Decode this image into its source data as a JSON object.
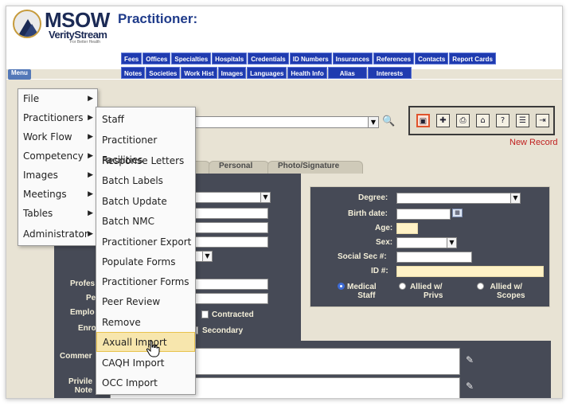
{
  "header": {
    "logo_brand": "MSOW",
    "logo_sub": "VerityStream",
    "logo_tiny": "For Better Health",
    "page_title": "Practitioner:"
  },
  "nav_row1": [
    "Fees",
    "Offices",
    "Specialties",
    "Hospitals",
    "Credentials",
    "ID Numbers",
    "Insurances",
    "References",
    "Contacts",
    "Report Cards"
  ],
  "nav_row2": [
    "Notes",
    "Societies",
    "Work Hist",
    "Images",
    "Languages",
    "Health Info",
    "Alias",
    "Interests"
  ],
  "menu_label": "Menu",
  "main_menu": [
    {
      "label": "File",
      "has_submenu": true
    },
    {
      "label": "Practitioners",
      "has_submenu": true
    },
    {
      "label": "Work Flow",
      "has_submenu": true
    },
    {
      "label": "Competency",
      "has_submenu": true
    },
    {
      "label": "Images",
      "has_submenu": true
    },
    {
      "label": "Meetings",
      "has_submenu": true
    },
    {
      "label": "Tables",
      "has_submenu": true
    },
    {
      "label": "Administrator",
      "has_submenu": true
    }
  ],
  "submenu": [
    "Staff",
    "Practitioner Facilities",
    "Response Letters",
    "Batch Labels",
    "Batch Update",
    "Batch NMC",
    "Practitioner Export",
    "Populate Forms",
    "Practitioner Forms",
    "Peer Review",
    "Remove Practitioner",
    "Axuall Import",
    "CAQH Import",
    "OCC Import"
  ],
  "submenu_hovered": "Axuall Import",
  "search": {
    "colon": ":"
  },
  "toolbar": {
    "icons": [
      "save-icon",
      "add-icon",
      "print-icon",
      "lock-icon",
      "help-icon",
      "list-icon",
      "exit-icon"
    ],
    "new_record": "New Record"
  },
  "tabs": [
    "Personal",
    "Photo/Signature"
  ],
  "form_left": {
    "professional_label": "Profes",
    "pe_label": "Pe",
    "employment_label": "Emplo",
    "enrollment_label": "Enro",
    "contracted_label": "Contracted",
    "secondary_label": "Secondary"
  },
  "form_right": {
    "degree_label": "Degree:",
    "birth_date_label": "Birth date:",
    "age_label": "Age:",
    "sex_label": "Sex:",
    "ssn_label": "Social Sec #:",
    "id_label": "ID #:",
    "radio_options": [
      {
        "line1": "Medical",
        "line2": "Staff",
        "selected": true
      },
      {
        "line1": "Allied w/",
        "line2": "Privs",
        "selected": false
      },
      {
        "line1": "Allied w/",
        "line2": "Scopes",
        "selected": false
      }
    ]
  },
  "form_bottom": {
    "comments_label": "Commer",
    "privileges_label_1": "Privile",
    "privileges_label_2": "Note"
  },
  "colors": {
    "nav_button": "#1f3bb0",
    "panel_bg": "#464a56",
    "page_bg": "#e8e3d4",
    "menu_hover": "#f7e6ad",
    "new_record": "#c02020"
  }
}
